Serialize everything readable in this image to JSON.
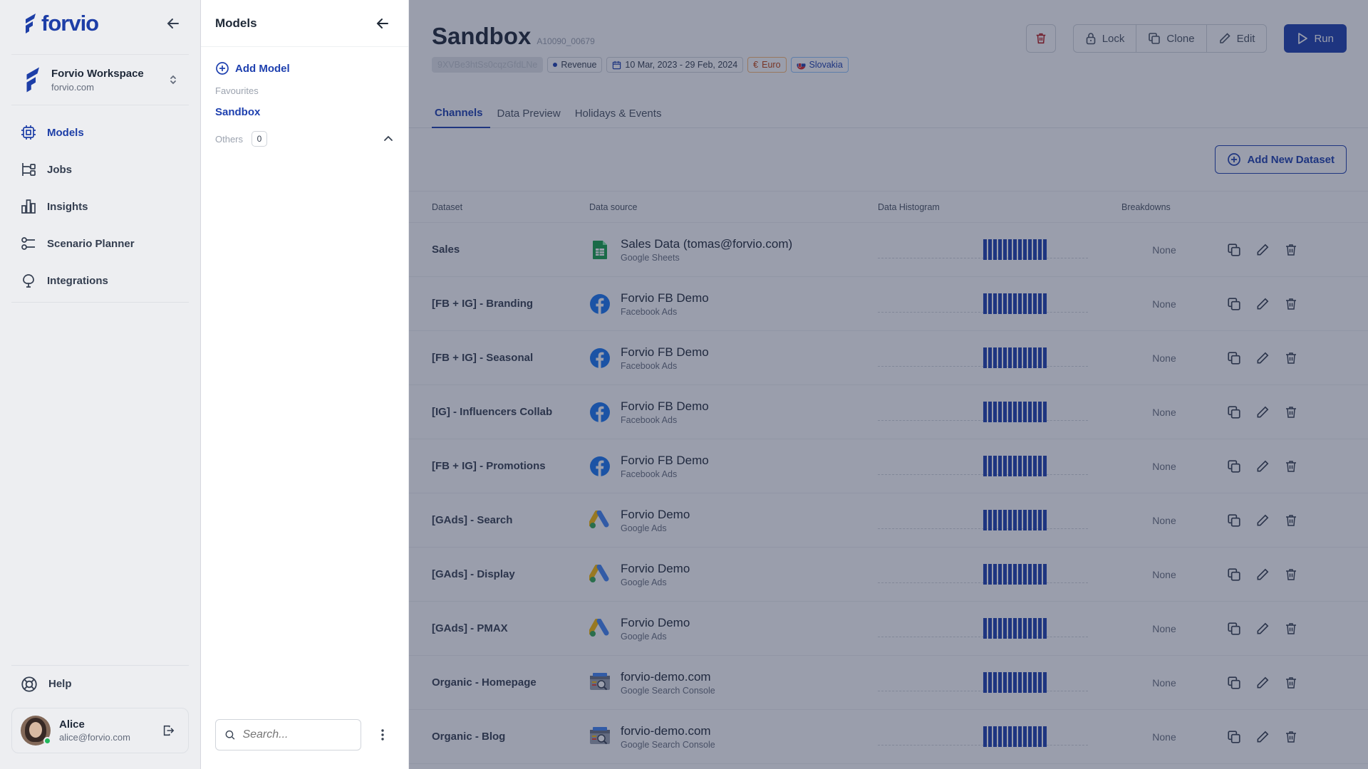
{
  "app": {
    "logo_text": "forvio",
    "workspace_name": "Forvio Workspace",
    "workspace_domain": "forvio.com"
  },
  "nav": {
    "items": [
      {
        "label": "Models",
        "icon": "models-icon"
      },
      {
        "label": "Jobs",
        "icon": "jobs-icon"
      },
      {
        "label": "Insights",
        "icon": "insights-icon"
      },
      {
        "label": "Scenario Planner",
        "icon": "scenario-icon"
      },
      {
        "label": "Integrations",
        "icon": "integrations-icon"
      }
    ],
    "help_label": "Help",
    "user_name": "Alice",
    "user_email": "alice@forvio.com"
  },
  "models_panel": {
    "title": "Models",
    "add_label": "Add Model",
    "favourites_label": "Favourites",
    "favourite_model": "Sandbox",
    "others_label": "Others",
    "others_count": "0",
    "search_placeholder": "Search..."
  },
  "model": {
    "title": "Sandbox",
    "id": "A10090_00679",
    "hash": "9XVBe3htSs0cqzGfdLNe",
    "target": "Revenue",
    "date_range": "10 Mar, 2023 - 29 Feb, 2024",
    "currency": "Euro",
    "country": "Slovakia"
  },
  "actions": {
    "lock": "Lock",
    "clone": "Clone",
    "edit": "Edit",
    "run": "Run"
  },
  "tabs": [
    "Channels",
    "Data Preview",
    "Holidays & Events"
  ],
  "add_dataset_label": "Add New Dataset",
  "table": {
    "headers": [
      "Dataset",
      "Data source",
      "Data Histogram",
      "Breakdowns"
    ],
    "rows": [
      {
        "dataset": "Sales",
        "source": "Sales Data (tomas@forvio.com)",
        "type": "Google Sheets",
        "icon": "sheets",
        "breakdowns": "None"
      },
      {
        "dataset": "[FB + IG] - Branding",
        "source": "Forvio FB Demo",
        "type": "Facebook Ads",
        "icon": "facebook",
        "breakdowns": "None"
      },
      {
        "dataset": "[FB + IG] - Seasonal",
        "source": "Forvio FB Demo",
        "type": "Facebook Ads",
        "icon": "facebook",
        "breakdowns": "None"
      },
      {
        "dataset": "[IG] - Influencers Collab",
        "source": "Forvio FB Demo",
        "type": "Facebook Ads",
        "icon": "facebook",
        "breakdowns": "None"
      },
      {
        "dataset": "[FB + IG] - Promotions",
        "source": "Forvio FB Demo",
        "type": "Facebook Ads",
        "icon": "facebook",
        "breakdowns": "None"
      },
      {
        "dataset": "[GAds] - Search",
        "source": "Forvio Demo",
        "type": "Google Ads",
        "icon": "gads",
        "breakdowns": "None"
      },
      {
        "dataset": "[GAds] - Display",
        "source": "Forvio Demo",
        "type": "Google Ads",
        "icon": "gads",
        "breakdowns": "None"
      },
      {
        "dataset": "[GAds] - PMAX",
        "source": "Forvio Demo",
        "type": "Google Ads",
        "icon": "gads",
        "breakdowns": "None"
      },
      {
        "dataset": "Organic - Homepage",
        "source": "forvio-demo.com",
        "type": "Google Search Console",
        "icon": "gsc",
        "breakdowns": "None"
      },
      {
        "dataset": "Organic - Blog",
        "source": "forvio-demo.com",
        "type": "Google Search Console",
        "icon": "gsc",
        "breakdowns": "None"
      }
    ]
  },
  "colors": {
    "accent": "#1e40af",
    "overlay": "#1f2948"
  }
}
